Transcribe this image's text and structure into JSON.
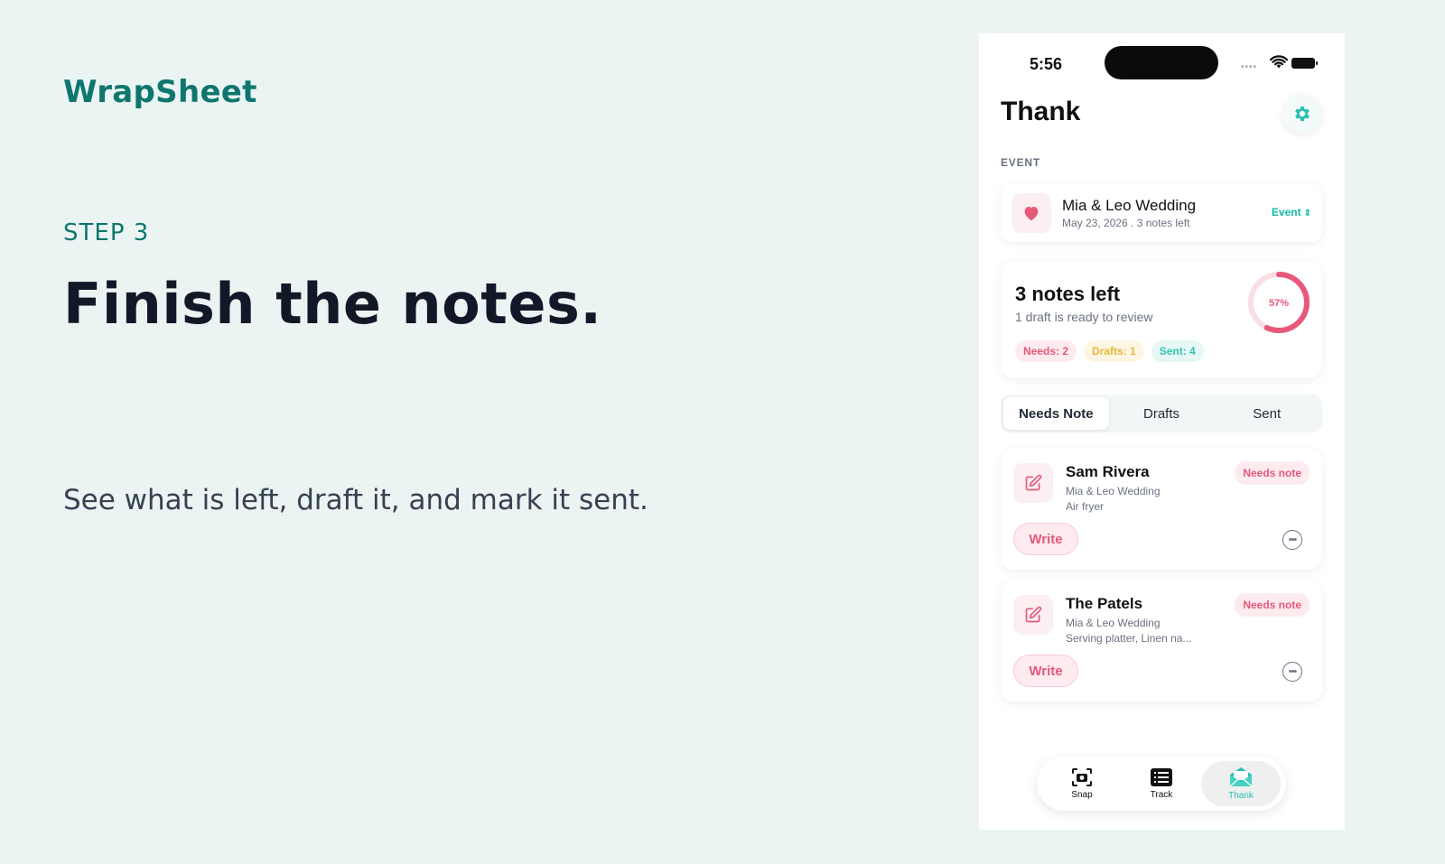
{
  "hero": {
    "brand": "WrapSheet",
    "step": "STEP 3",
    "headline": "Finish the notes.",
    "subline": "See what is left, draft it, and mark it sent."
  },
  "phone": {
    "status": {
      "time": "5:56"
    },
    "title": "Thank",
    "section_label": "EVENT",
    "event": {
      "name": "Mia & Leo Wedding",
      "meta": "May 23, 2026 . 3 notes left",
      "selector_label": "Event"
    },
    "summary": {
      "title": "3 notes left",
      "subtitle": "1 draft is ready to review",
      "progress_label": "57%",
      "progress_value": 0.57,
      "chips": {
        "needs": "Needs: 2",
        "drafts": "Drafts: 1",
        "sent": "Sent: 4"
      }
    },
    "tabs": [
      "Needs Note",
      "Drafts",
      "Sent"
    ],
    "notes": [
      {
        "name": "Sam Rivera",
        "event": "Mia & Leo Wedding",
        "items": "Air fryer",
        "badge": "Needs note",
        "action": "Write"
      },
      {
        "name": "The Patels",
        "event": "Mia & Leo Wedding",
        "items": "Serving platter, Linen na...",
        "badge": "Needs note",
        "action": "Write"
      }
    ],
    "nav": [
      {
        "label": "Snap",
        "icon": "camera-icon"
      },
      {
        "label": "Track",
        "icon": "list-icon"
      },
      {
        "label": "Thank",
        "icon": "envelope-icon"
      }
    ]
  },
  "colors": {
    "brand": "#0f766e",
    "accent": "#14b8a6",
    "pink": "#e7587a"
  }
}
